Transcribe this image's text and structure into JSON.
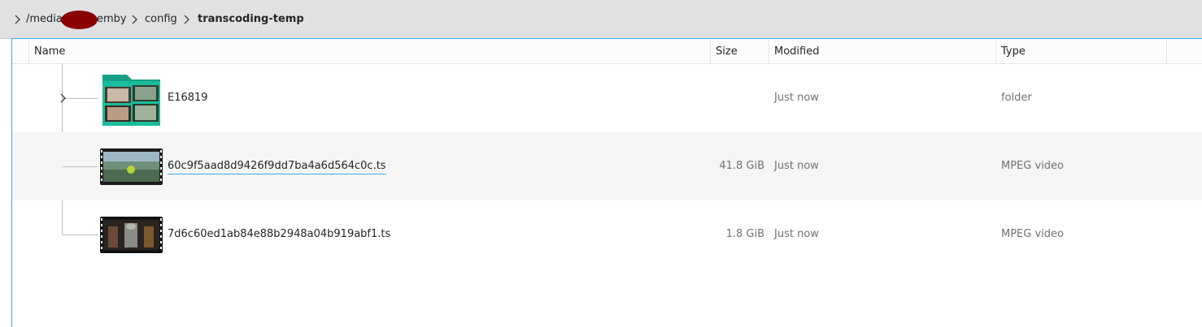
{
  "breadcrumb": {
    "seg1": "/media",
    "seg2": "emby",
    "seg3": "config",
    "current": "transcoding-temp"
  },
  "columns": {
    "name": "Name",
    "size": "Size",
    "modified": "Modified",
    "type": "Type"
  },
  "rows": [
    {
      "name": "E16819",
      "size": "",
      "modified": "Just now",
      "type": "folder",
      "icon": "folder-icon"
    },
    {
      "name": "60c9f5aad8d9426f9dd7ba4a6d564c0c.ts",
      "size": "41.8 GiB",
      "modified": "Just now",
      "type": "MPEG video",
      "icon": "video-thumbnail-icon"
    },
    {
      "name": "7d6c60ed1ab84e88b2948a04b919abf1.ts",
      "size": "1.8 GiB",
      "modified": "Just now",
      "type": "MPEG video",
      "icon": "video-thumbnail-icon"
    }
  ],
  "colors": {
    "accent": "#3daee9",
    "folder": "#1abc9c",
    "redaction": "#8b0000"
  }
}
